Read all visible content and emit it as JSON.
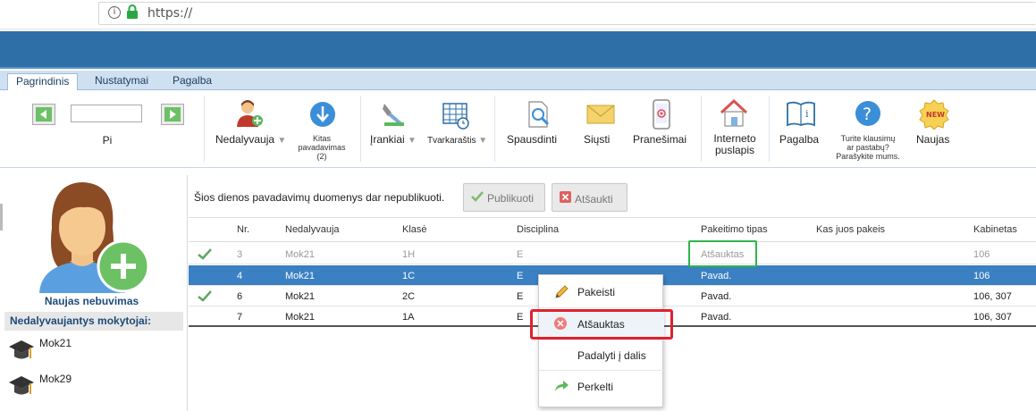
{
  "browser": {
    "url": "https://"
  },
  "tabs": [
    "Pagrindinis",
    "Nustatymai",
    "Pagalba"
  ],
  "ribbon": {
    "date_value": "",
    "date_label": "Pi",
    "nedalyvauja": "Nedalyvauja",
    "kitas_pavadavimas": "Kitas pavadavimas",
    "kitas_count": "(2)",
    "irankiai": "Įrankiai",
    "tvarkarastis": "Tvarkaraštis",
    "spausdinti": "Spausdinti",
    "siusti": "Siųsti",
    "pranesimai": "Pranešimai",
    "interneto": "Interneto",
    "puslapis": "puslapis",
    "pagalba": "Pagalba",
    "klausimu_1": "Turite klausimų",
    "klausimu_2": "ar pastabų?",
    "klausimu_3": "Parašykite mums.",
    "naujas": "Naujas",
    "new_badge": "NEW"
  },
  "left": {
    "new_absence": "Naujas nebuvimas",
    "teachers_header": "Nedalyvaujantys mokytojai:",
    "teachers": [
      "Mok21",
      "Mok29"
    ]
  },
  "main": {
    "notice": "Šios dienos pavadavimų duomenys dar nepublikuoti.",
    "publish": "Publikuoti",
    "cancel": "Atšaukti"
  },
  "table": {
    "headers": [
      "Nr.",
      "Nedalyvauja",
      "Klasė",
      "Disciplina",
      "Pakeitimo tipas",
      "Kas juos pakeis",
      "Kabinetas"
    ],
    "rows": [
      {
        "check": true,
        "nr": "3",
        "teacher": "Mok21",
        "class": "1H",
        "discipline": "E",
        "type": "Atšauktas",
        "replacer": "",
        "room": "106"
      },
      {
        "check": false,
        "nr": "4",
        "teacher": "Mok21",
        "class": "1C",
        "discipline": "E",
        "type": "Pavad.",
        "replacer": "",
        "room": "106"
      },
      {
        "check": true,
        "nr": "6",
        "teacher": "Mok21",
        "class": "2C",
        "discipline": "E",
        "type": "Pavad.",
        "replacer": "",
        "room": "106, 307"
      },
      {
        "check": false,
        "nr": "7",
        "teacher": "Mok21",
        "class": "1A",
        "discipline": "E",
        "type": "Pavad.",
        "replacer": "",
        "room": "106, 307"
      }
    ]
  },
  "context_menu": [
    "Pakeisti",
    "Atšauktas",
    "Padalyti į dalis",
    "Perkelti"
  ],
  "colors": {
    "header": "#2f6fa7",
    "selected_row": "#3a80c3",
    "highlight_green": "#2fb54a",
    "highlight_red": "#e0202e"
  }
}
